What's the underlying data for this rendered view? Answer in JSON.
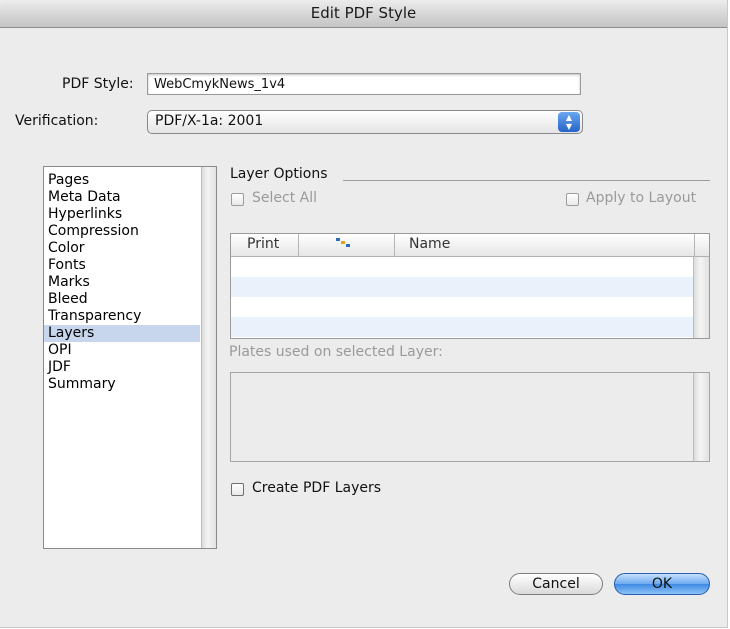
{
  "window": {
    "title": "Edit PDF Style"
  },
  "pdf_style": {
    "label": "PDF Style:",
    "value": "WebCmykNews_1v4"
  },
  "verification": {
    "label": "Verification:",
    "selected": "PDF/X-1a: 2001"
  },
  "sidebar": {
    "items": [
      {
        "label": "Pages",
        "selected": false
      },
      {
        "label": "Meta Data",
        "selected": false
      },
      {
        "label": "Hyperlinks",
        "selected": false
      },
      {
        "label": "Compression",
        "selected": false
      },
      {
        "label": "Color",
        "selected": false
      },
      {
        "label": "Fonts",
        "selected": false
      },
      {
        "label": "Marks",
        "selected": false
      },
      {
        "label": "Bleed",
        "selected": false
      },
      {
        "label": "Transparency",
        "selected": false
      },
      {
        "label": "Layers",
        "selected": true
      },
      {
        "label": "OPI",
        "selected": false
      },
      {
        "label": "JDF",
        "selected": false
      },
      {
        "label": "Summary",
        "selected": false
      }
    ]
  },
  "layer_options": {
    "title": "Layer Options",
    "select_all_label": "Select All",
    "apply_to_layout_label": "Apply to Layout",
    "table": {
      "columns": [
        "Print",
        "",
        "Name"
      ],
      "rows": []
    },
    "plates_label": "Plates used on selected Layer:",
    "create_pdf_layers_label": "Create PDF Layers",
    "create_pdf_layers_checked": false
  },
  "buttons": {
    "cancel_label": "Cancel",
    "ok_label": "OK"
  },
  "colors": {
    "selection": "#c7d6ec",
    "default_button": "#3d89e4",
    "window_bg": "#ececec"
  },
  "icons": {
    "popup_arrows": "updown-arrows-icon",
    "layer_column": "layer-squares-icon"
  }
}
